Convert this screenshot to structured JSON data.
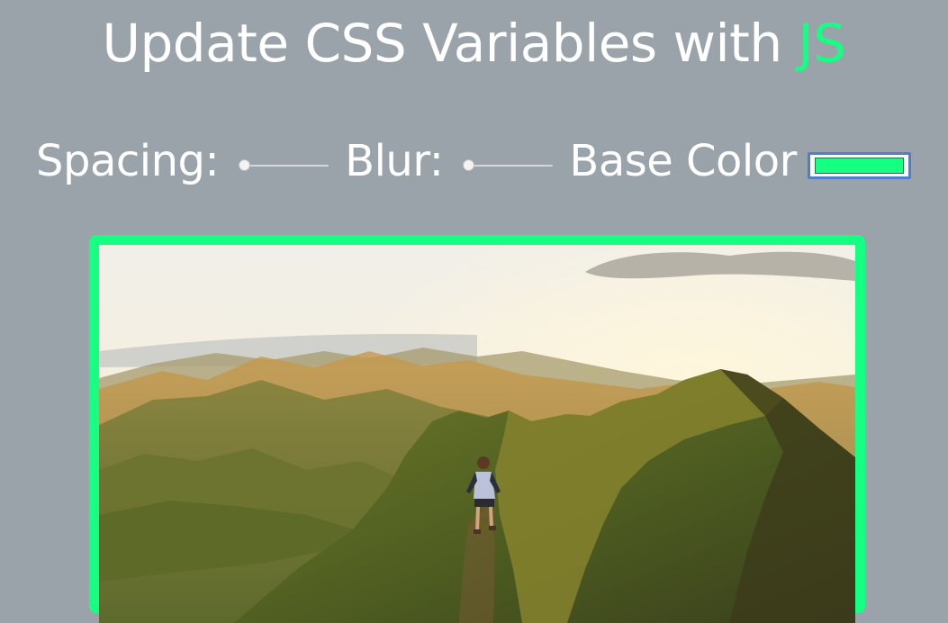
{
  "heading": {
    "text": "Update CSS Variables with ",
    "highlight": "JS",
    "highlight_color": "#15ff83"
  },
  "controls": {
    "spacing": {
      "label": "Spacing:",
      "value_fraction": 0.0
    },
    "blur": {
      "label": "Blur:",
      "value_fraction": 0.0
    },
    "base_color": {
      "label": "Base Color",
      "value": "#15ff83"
    }
  },
  "page_background": "#9aa3aa",
  "image": {
    "subject": "hiker walking on a green mountain ridge at sunset",
    "border_color": "#15ff83"
  }
}
